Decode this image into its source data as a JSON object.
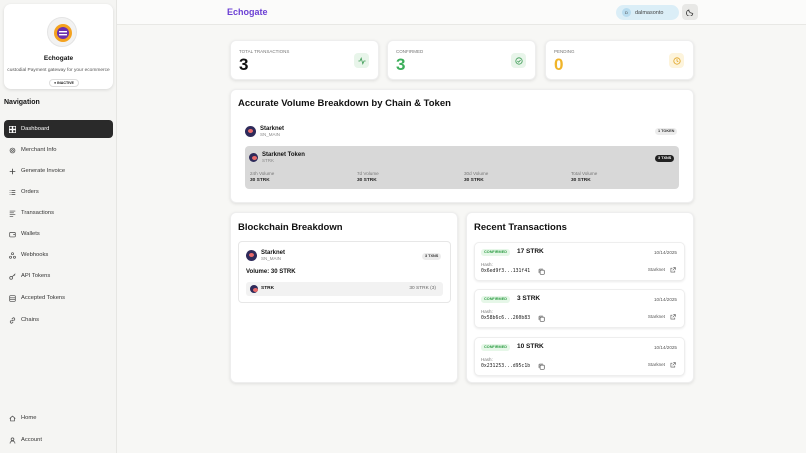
{
  "app": {
    "brand": "Echogate"
  },
  "profile": {
    "name": "Echogate",
    "description": "custodial Payment gateway for your ecommerce",
    "status": "INACTIVE"
  },
  "navigation": {
    "title": "Navigation",
    "items": [
      {
        "label": "Dashboard",
        "icon": "dashboard-icon",
        "active": true
      },
      {
        "label": "Merchant Info",
        "icon": "gear-icon"
      },
      {
        "label": "Generate Invoice",
        "icon": "plus-icon"
      },
      {
        "label": "Orders",
        "icon": "list-icon"
      },
      {
        "label": "Transactions",
        "icon": "transactions-icon"
      },
      {
        "label": "Wallets",
        "icon": "wallet-icon"
      },
      {
        "label": "Webhooks",
        "icon": "webhook-icon"
      },
      {
        "label": "API Tokens",
        "icon": "key-icon"
      },
      {
        "label": "Accepted Tokens",
        "icon": "database-icon"
      },
      {
        "label": "Chains",
        "icon": "link-icon"
      }
    ],
    "bottom": [
      {
        "label": "Home",
        "icon": "home-icon"
      },
      {
        "label": "Account",
        "icon": "user-icon"
      }
    ]
  },
  "header": {
    "user_initial": "D",
    "username": "dalmasonto"
  },
  "stats": [
    {
      "label": "TOTAL TRANSACTIONS",
      "value": "3",
      "color": "#111111",
      "icon": "activity-icon",
      "icon_bg": "#e8f5ea",
      "icon_color": "#3a9a53"
    },
    {
      "label": "CONFIRMED",
      "value": "3",
      "color": "#3cae5a",
      "icon": "check-circle-icon",
      "icon_bg": "#e8f5ea",
      "icon_color": "#3a9a53"
    },
    {
      "label": "PENDING",
      "value": "0",
      "color": "#f0b429",
      "icon": "clock-icon",
      "icon_bg": "#fdf4dc",
      "icon_color": "#e0a321"
    }
  ],
  "volume_breakdown": {
    "title": "Accurate Volume Breakdown by Chain & Token",
    "chain_name": "Starknet",
    "chain_network": "SN_MAIN",
    "token_count": "1 TOKEN",
    "token_name": "Starknet Token",
    "token_symbol": "STRK",
    "tx_count": "3 TXNS",
    "metrics": [
      {
        "label": "24h Volume",
        "value": "30 STRK"
      },
      {
        "label": "7d Volume",
        "value": "30 STRK"
      },
      {
        "label": "30d Volume",
        "value": "30 STRK"
      },
      {
        "label": "Total Volume",
        "value": "30 STRK"
      }
    ]
  },
  "blockchain_breakdown": {
    "title": "Blockchain Breakdown",
    "chain_name": "Starknet",
    "chain_network": "SN_MAIN",
    "tx_count": "3 TXNS",
    "volume": "Volume: 30 STRK",
    "token_symbol": "STRK",
    "token_amount": "30 STRK (3)"
  },
  "recent_transactions": {
    "title": "Recent Transactions",
    "items": [
      {
        "status": "CONFIRMED",
        "amount": "17 STRK",
        "date": "10/14/2025",
        "hash_label": "Hash:",
        "hash": "0x6ed9f3...131f41",
        "chain": "Starknet"
      },
      {
        "status": "CONFIRMED",
        "amount": "3 STRK",
        "date": "10/14/2025",
        "hash_label": "Hash:",
        "hash": "0x58b6c6...260b83",
        "chain": "Starknet"
      },
      {
        "status": "CONFIRMED",
        "amount": "10 STRK",
        "date": "10/14/2025",
        "hash_label": "Hash:",
        "hash": "0x231253...d95c1b",
        "chain": "Starknet"
      }
    ]
  }
}
